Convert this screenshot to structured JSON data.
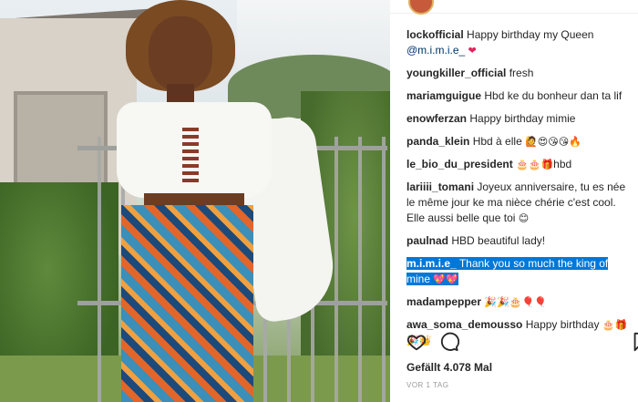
{
  "post": {
    "comments": [
      {
        "user": "lockofficial",
        "text": "Happy birthday my Queen",
        "mention": "@m.i.m.i.e_",
        "emoji": "❤"
      },
      {
        "user": "youngkiller_official",
        "text": "fresh"
      },
      {
        "user": "mariamguigue",
        "text": "Hbd ke du bonheur dan ta lif"
      },
      {
        "user": "enowferzan",
        "text": "Happy birthday mimie"
      },
      {
        "user": "panda_klein",
        "text": "Hbd à elle",
        "emoji": "🙋😍😘😘🔥"
      },
      {
        "user": "le_bio_du_president",
        "text": "",
        "emoji": "🎂🎂🎁",
        "suffix": "hbd"
      },
      {
        "user": "lariiii_tomani",
        "text": "Joyeux anniversaire, tu es née le même jour ke ma nièce chérie c'est cool. Elle aussi belle que toi",
        "emoji": "😊"
      },
      {
        "user": "paulnad",
        "text": "HBD beautiful lady!"
      },
      {
        "user": "m.i.m.i.e_",
        "text": "Thank you so much the king of mine",
        "emoji": "💖💖",
        "highlighted": true
      },
      {
        "user": "madampepper",
        "text": "",
        "emoji": "🎉🎉🎂🎈🎈"
      },
      {
        "user": "awa_soma_demousso",
        "text": "Happy birthday",
        "emoji": "🎂🎁🎉👑"
      }
    ],
    "likes": "Gefällt 4.078 Mal",
    "timestamp": "VOR 1 TAG"
  },
  "icons": {
    "like": "heart-icon",
    "comment": "comment-icon",
    "save": "bookmark-icon"
  },
  "colors": {
    "selection": "#0078d7",
    "mention": "#003569"
  }
}
